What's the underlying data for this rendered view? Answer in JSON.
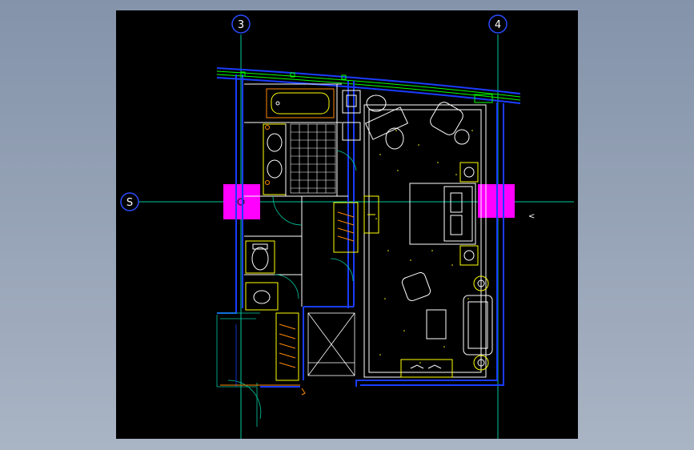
{
  "drawing": {
    "grid_labels": {
      "col_left": "3",
      "col_right": "4",
      "row": "S"
    },
    "colors": {
      "background": "#000000",
      "page": "#8e9bb0",
      "grid_line": "#00c8a0",
      "grid_bubble": "#2a4cff",
      "walls": "#1a3cff",
      "furniture": "#ffff00",
      "fixtures": "#ffffff",
      "highlight": "#ff00ff",
      "accent_orange": "#ff8a00",
      "window": "#00ff00"
    },
    "icons": [
      "grid-bubble-icon",
      "section-marker-icon"
    ]
  }
}
